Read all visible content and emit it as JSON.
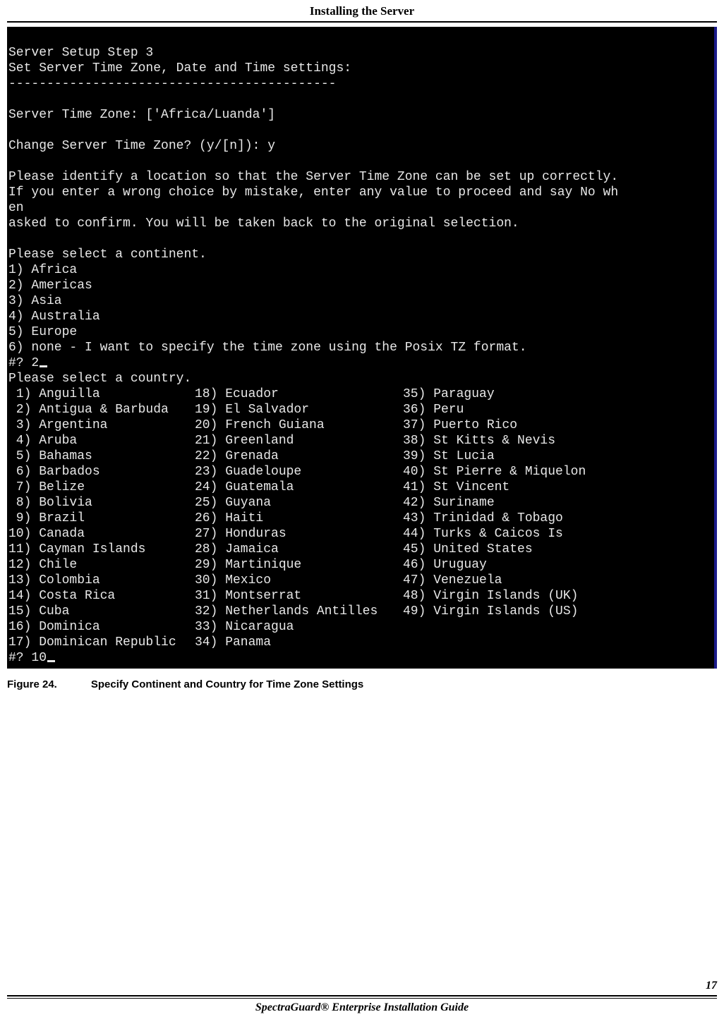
{
  "header": {
    "title": "Installing the Server"
  },
  "terminal": {
    "step_line": "Server Setup Step 3",
    "subtitle": "Set Server Time Zone, Date and Time settings:",
    "divider": "-------------------------------------------",
    "tz_line": "Server Time Zone: ['Africa/Luanda']",
    "change_prompt": "Change Server Time Zone? (y/[n]): ",
    "change_answer": "y",
    "para_line1": "Please identify a location so that the Server Time Zone can be set up correctly.",
    "para_line2": "If you enter a wrong choice by mistake, enter any value to proceed and say No wh",
    "para_line3": "en",
    "para_line4": "asked to confirm. You will be taken back to the original selection.",
    "continent_prompt": "Please select a continent.",
    "continents": [
      "1) Africa",
      "2) Americas",
      "3) Asia",
      "4) Australia",
      "5) Europe",
      "6) none - I want to specify the time zone using the Posix TZ format."
    ],
    "continent_input_prompt": "#? ",
    "continent_input_value": "2",
    "country_prompt": "Please select a country.",
    "countries_col1": [
      " 1) Anguilla",
      " 2) Antigua & Barbuda",
      " 3) Argentina",
      " 4) Aruba",
      " 5) Bahamas",
      " 6) Barbados",
      " 7) Belize",
      " 8) Bolivia",
      " 9) Brazil",
      "10) Canada",
      "11) Cayman Islands",
      "12) Chile",
      "13) Colombia",
      "14) Costa Rica",
      "15) Cuba",
      "16) Dominica",
      "17) Dominican Republic"
    ],
    "countries_col2": [
      "18) Ecuador",
      "19) El Salvador",
      "20) French Guiana",
      "21) Greenland",
      "22) Grenada",
      "23) Guadeloupe",
      "24) Guatemala",
      "25) Guyana",
      "26) Haiti",
      "27) Honduras",
      "28) Jamaica",
      "29) Martinique",
      "30) Mexico",
      "31) Montserrat",
      "32) Netherlands Antilles",
      "33) Nicaragua",
      "34) Panama"
    ],
    "countries_col3": [
      "35) Paraguay",
      "36) Peru",
      "37) Puerto Rico",
      "38) St Kitts & Nevis",
      "39) St Lucia",
      "40) St Pierre & Miquelon",
      "41) St Vincent",
      "42) Suriname",
      "43) Trinidad & Tobago",
      "44) Turks & Caicos Is",
      "45) United States",
      "46) Uruguay",
      "47) Venezuela",
      "48) Virgin Islands (UK)",
      "49) Virgin Islands (US)",
      "",
      ""
    ],
    "country_input_prompt": "#? ",
    "country_input_value": "10"
  },
  "caption": {
    "label": "Figure  24.",
    "text": "Specify Continent and Country for Time Zone Settings"
  },
  "footer": {
    "page_number": "17",
    "guide": "SpectraGuard® Enterprise Installation Guide"
  }
}
